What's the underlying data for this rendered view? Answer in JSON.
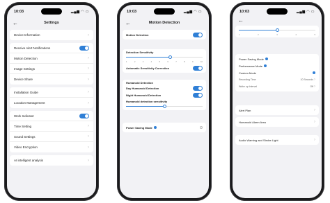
{
  "phones": [
    {
      "status_time": "10:03",
      "status_icons": "▂▄▆ ◠ ▭",
      "back_glyph": "←",
      "title": "Settings",
      "groups": [
        [
          "Device Information"
        ],
        [
          "Receive Alert Notifications",
          "Motion Detection",
          "Image Settings",
          "Device Share"
        ],
        [
          "Installation Guide",
          "Location Management"
        ],
        [
          "Work Indicator",
          "Time Setting",
          "Sound Settings",
          "Video Encryption"
        ],
        [
          "AI intelligent analysis"
        ]
      ]
    },
    {
      "status_time": "10:03",
      "status_icons": "▂▄▆ ◠ ▭",
      "back_glyph": "←",
      "title": "Motion Detection",
      "motion_label": "Motion Detection",
      "sens_label": "Detection Sensitivity",
      "ticks": [
        "1",
        "2",
        "3",
        "4",
        "5",
        "6",
        "7",
        "8",
        "9",
        "10"
      ],
      "auto_label": "Automatic Sensitivity Correction",
      "humanoid_header": "Humanoid Detection",
      "day_label": "Day Humanoid Detection",
      "night_label": "Night Humanoid Detection",
      "hsens_label": "Humanoid detection sensitivity",
      "doorbell_label": "Power Saving Mode"
    },
    {
      "status_time": "10:03",
      "status_icons": "▂▄▆ ◠ ▭",
      "back_glyph": "←",
      "ticks": [
        "1",
        "2",
        "3",
        "4",
        "5"
      ],
      "modes": [
        "Power Saving Mode",
        "Performance Mode",
        "Custom Mode"
      ],
      "recording_label": "Recording Time",
      "recording_value": "10 Seconds",
      "wakeup_label": "Wake up Interval",
      "wakeup_value": "Off",
      "alert_label": "Alert Plan",
      "area_label": "Humanoid Alarm Area",
      "strobe_label": "Audio Warning and Strobe Light"
    }
  ]
}
